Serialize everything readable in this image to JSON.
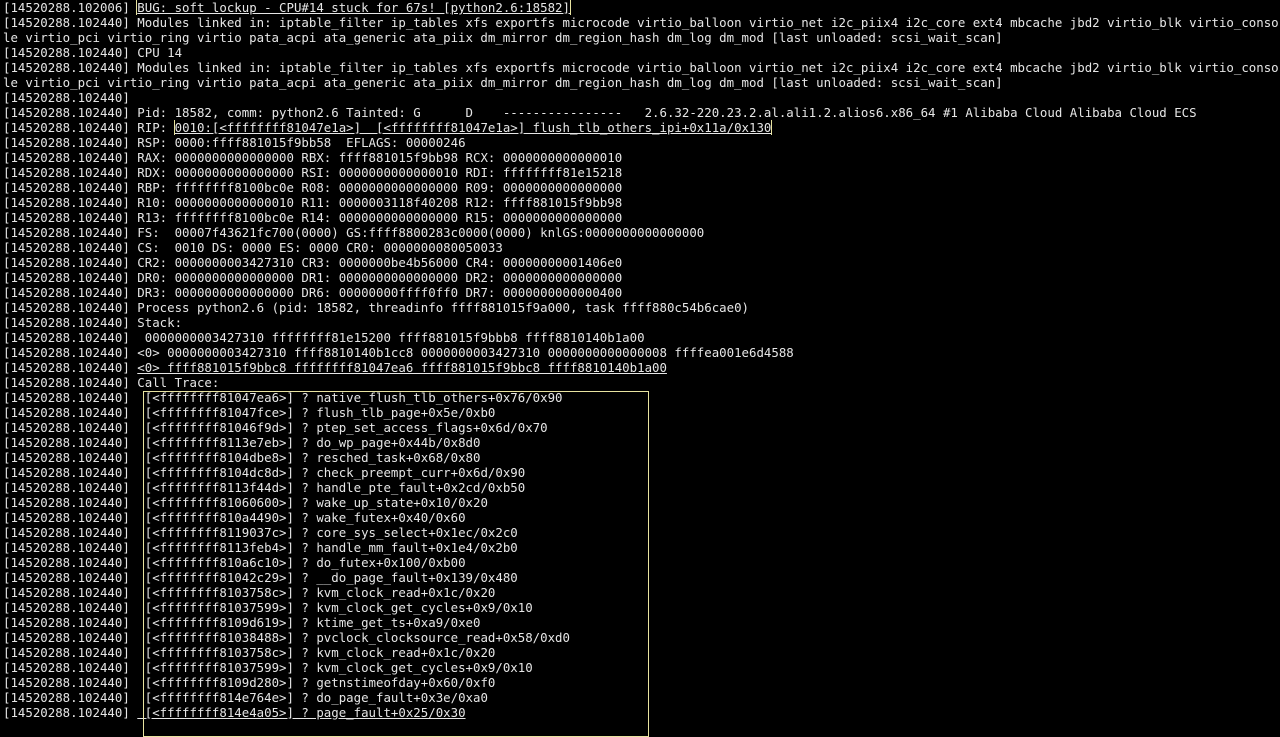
{
  "terminal": {
    "lines": [
      {
        "ts": "[14520288.102006]",
        "msg": "BUG: soft lockup - CPU#14 stuck for 67s! [python2.6:18582]",
        "boxed": true
      },
      {
        "ts": "[14520288.102440]",
        "msg": "Modules linked in: iptable_filter ip_tables xfs exportfs microcode virtio_balloon virtio_net i2c_piix4 i2c_core ext4 mbcache jbd2 virtio_blk virtio_console virtio_pci virtio_ring virtio pata_acpi ata_generic ata_piix dm_mirror dm_region_hash dm_log dm_mod [last unloaded: scsi_wait_scan]",
        "wrap": true
      },
      {
        "ts": "[14520288.102440]",
        "msg": "CPU 14"
      },
      {
        "ts": "[14520288.102440]",
        "msg": "Modules linked in: iptable_filter ip_tables xfs exportfs microcode virtio_balloon virtio_net i2c_piix4 i2c_core ext4 mbcache jbd2 virtio_blk virtio_console virtio_pci virtio_ring virtio pata_acpi ata_generic ata_piix dm_mirror dm_region_hash dm_log dm_mod [last unloaded: scsi_wait_scan]",
        "wrap": true
      },
      {
        "ts": "[14520288.102440]",
        "msg": ""
      },
      {
        "ts": "[14520288.102440]",
        "msg": "Pid: 18582, comm: python2.6 Tainted: G      D    ----------------   2.6.32-220.23.2.al.ali1.2.alios6.x86_64 #1 Alibaba Cloud Alibaba Cloud ECS",
        "wrap": true
      },
      {
        "ts": "[14520288.102440]",
        "msg_prefix": "RIP: ",
        "msg": "0010:[<ffffffff81047e1a>]  [<ffffffff81047e1a>] flush_tlb_others_ipi+0x11a/0x130",
        "boxed": true
      },
      {
        "ts": "[14520288.102440]",
        "msg": "RSP: 0000:ffff881015f9bb58  EFLAGS: 00000246"
      },
      {
        "ts": "[14520288.102440]",
        "msg": "RAX: 0000000000000000 RBX: ffff881015f9bb98 RCX: 0000000000000010"
      },
      {
        "ts": "[14520288.102440]",
        "msg": "RDX: 0000000000000000 RSI: 0000000000000010 RDI: ffffffff81e15218"
      },
      {
        "ts": "[14520288.102440]",
        "msg": "RBP: ffffffff8100bc0e R08: 0000000000000000 R09: 0000000000000000"
      },
      {
        "ts": "[14520288.102440]",
        "msg": "R10: 0000000000000010 R11: 0000003118f40208 R12: ffff881015f9bb98"
      },
      {
        "ts": "[14520288.102440]",
        "msg": "R13: ffffffff8100bc0e R14: 0000000000000000 R15: 0000000000000000"
      },
      {
        "ts": "[14520288.102440]",
        "msg": "FS:  00007f43621fc700(0000) GS:ffff8800283c0000(0000) knlGS:0000000000000000"
      },
      {
        "ts": "[14520288.102440]",
        "msg": "CS:  0010 DS: 0000 ES: 0000 CR0: 0000000080050033"
      },
      {
        "ts": "[14520288.102440]",
        "msg": "CR2: 0000000003427310 CR3: 0000000be4b56000 CR4: 00000000001406e0"
      },
      {
        "ts": "[14520288.102440]",
        "msg": "DR0: 0000000000000000 DR1: 0000000000000000 DR2: 0000000000000000"
      },
      {
        "ts": "[14520288.102440]",
        "msg": "DR3: 0000000000000000 DR6: 00000000ffff0ff0 DR7: 0000000000000400"
      },
      {
        "ts": "[14520288.102440]",
        "msg": "Process python2.6 (pid: 18582, threadinfo ffff881015f9a000, task ffff880c54b6cae0)"
      },
      {
        "ts": "[14520288.102440]",
        "msg": "Stack:"
      },
      {
        "ts": "[14520288.102440]",
        "msg": " 0000000003427310 ffffffff81e15200 ffff881015f9bbb8 ffff8810140b1a00"
      },
      {
        "ts": "[14520288.102440]",
        "msg": "<0> 0000000003427310 ffff8810140b1cc8 0000000003427310 0000000000000008 ffffea001e6d4588"
      },
      {
        "ts": "[14520288.102440]",
        "msg": "<0> ffff881015f9bbc8 ffffffff81047ea6 ffff881015f9bbc8 ffff8810140b1a00",
        "underline": true
      },
      {
        "ts": "[14520288.102440]",
        "msg": "Call Trace:"
      },
      {
        "ts": "[14520288.102440]",
        "msg": " [<ffffffff81047ea6>] ? native_flush_tlb_others+0x76/0x90"
      },
      {
        "ts": "[14520288.102440]",
        "msg": " [<ffffffff81047fce>] ? flush_tlb_page+0x5e/0xb0"
      },
      {
        "ts": "[14520288.102440]",
        "msg": " [<ffffffff81046f9d>] ? ptep_set_access_flags+0x6d/0x70"
      },
      {
        "ts": "[14520288.102440]",
        "msg": " [<ffffffff8113e7eb>] ? do_wp_page+0x44b/0x8d0"
      },
      {
        "ts": "[14520288.102440]",
        "msg": " [<ffffffff8104dbe8>] ? resched_task+0x68/0x80"
      },
      {
        "ts": "[14520288.102440]",
        "msg": " [<ffffffff8104dc8d>] ? check_preempt_curr+0x6d/0x90"
      },
      {
        "ts": "[14520288.102440]",
        "msg": " [<ffffffff8113f44d>] ? handle_pte_fault+0x2cd/0xb50"
      },
      {
        "ts": "[14520288.102440]",
        "msg": " [<ffffffff81060600>] ? wake_up_state+0x10/0x20"
      },
      {
        "ts": "[14520288.102440]",
        "msg": " [<ffffffff810a4490>] ? wake_futex+0x40/0x60"
      },
      {
        "ts": "[14520288.102440]",
        "msg": " [<ffffffff8119037c>] ? core_sys_select+0x1ec/0x2c0"
      },
      {
        "ts": "[14520288.102440]",
        "msg": " [<ffffffff8113feb4>] ? handle_mm_fault+0x1e4/0x2b0"
      },
      {
        "ts": "[14520288.102440]",
        "msg": " [<ffffffff810a6c10>] ? do_futex+0x100/0xb00"
      },
      {
        "ts": "[14520288.102440]",
        "msg": " [<ffffffff81042c29>] ? __do_page_fault+0x139/0x480"
      },
      {
        "ts": "[14520288.102440]",
        "msg": " [<ffffffff8103758c>] ? kvm_clock_read+0x1c/0x20"
      },
      {
        "ts": "[14520288.102440]",
        "msg": " [<ffffffff81037599>] ? kvm_clock_get_cycles+0x9/0x10"
      },
      {
        "ts": "[14520288.102440]",
        "msg": " [<ffffffff8109d619>] ? ktime_get_ts+0xa9/0xe0"
      },
      {
        "ts": "[14520288.102440]",
        "msg": " [<ffffffff81038488>] ? pvclock_clocksource_read+0x58/0xd0"
      },
      {
        "ts": "[14520288.102440]",
        "msg": " [<ffffffff8103758c>] ? kvm_clock_read+0x1c/0x20"
      },
      {
        "ts": "[14520288.102440]",
        "msg": " [<ffffffff81037599>] ? kvm_clock_get_cycles+0x9/0x10"
      },
      {
        "ts": "[14520288.102440]",
        "msg": " [<ffffffff8109d280>] ? getnstimeofday+0x60/0xf0"
      },
      {
        "ts": "[14520288.102440]",
        "msg": " [<ffffffff814e764e>] ? do_page_fault+0x3e/0xa0"
      },
      {
        "ts": "[14520288.102440]",
        "msg": " [<ffffffff814e4a05>] ? page_fault+0x25/0x30",
        "underline": true
      }
    ]
  },
  "colors": {
    "background": "#000000",
    "text": "#e6e6e6",
    "highlight_box": "#e8e3a0"
  }
}
